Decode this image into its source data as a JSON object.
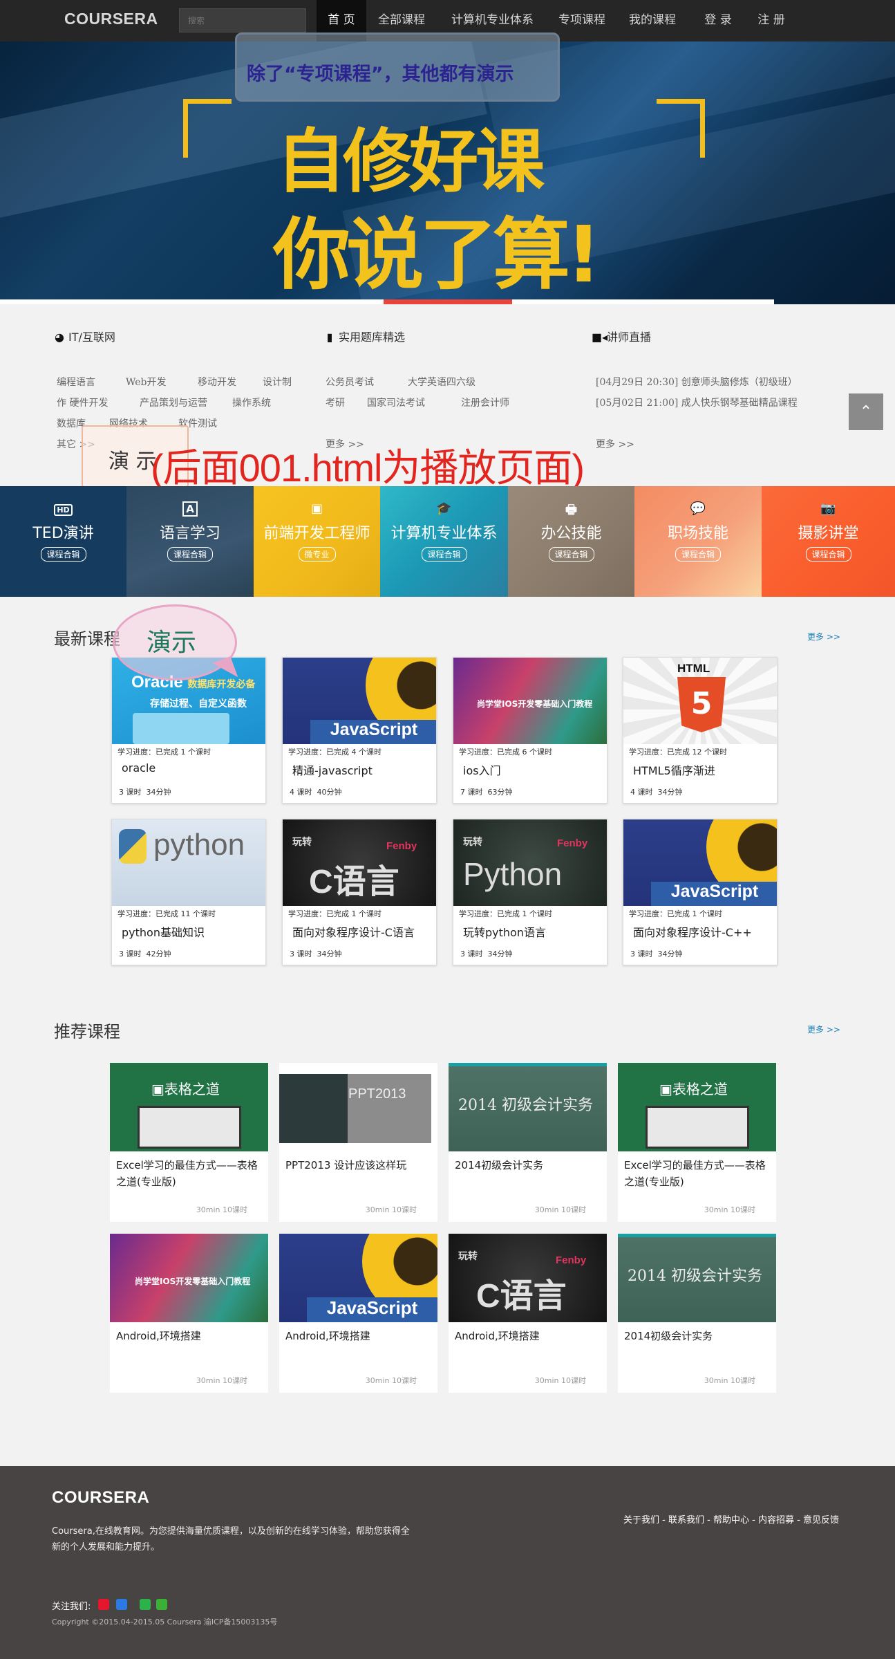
{
  "header": {
    "logo": "COURSERA",
    "search_placeholder": "搜索",
    "nav": [
      "首 页",
      "全部课程",
      "计算机专业体系",
      "专项课程",
      "我的课程",
      "登 录",
      "注 册"
    ]
  },
  "banner": {
    "demo_note": "除了“专项课程”，其他都有演示",
    "line1": "自修好课",
    "line2": "你说了算!"
  },
  "categories": {
    "col1": {
      "title": "IT/互联网",
      "icon": "globe-icon",
      "rows": [
        [
          "编程语言",
          "Web开发",
          "移动开发",
          "设计制"
        ],
        [
          "作 硬件开发",
          "产品策划与运营",
          "操作系统"
        ],
        [
          "数据库",
          "网络技术",
          "软件测试"
        ],
        [
          "其它 >>"
        ]
      ]
    },
    "col2": {
      "title": "实用题库精选",
      "icon": "book-icon",
      "rows": [
        [
          "公务员考试",
          "大学英语四六级"
        ],
        [
          "考研",
          "国家司法考试",
          "注册会计师"
        ],
        [
          "更多 >>"
        ]
      ]
    },
    "col3": {
      "title": "讲师直播",
      "icon": "video-camera-icon",
      "rows": [
        "[04月29日 20:30] 创意师头脑修炼（初级班）",
        "[05月02日 21:00] 成人快乐钢琴基础精品课程",
        "更多 >>"
      ]
    },
    "demo_label": "演 示",
    "red_note": "(后面001.html为播放页面)"
  },
  "tiles": [
    {
      "name": "TED演讲",
      "badge": "课程合辑",
      "icon": "HD",
      "color": "#153c5e"
    },
    {
      "name": "语言学习",
      "badge": "课程合辑",
      "icon": "A",
      "color": "#2c4960"
    },
    {
      "name": "前端开发工程师",
      "badge": "微专业",
      "icon": "▣",
      "color": "#f3c01f"
    },
    {
      "name": "计算机专业体系",
      "badge": "课程合辑",
      "icon": "🎓",
      "color": "#28aabd"
    },
    {
      "name": "办公技能",
      "badge": "课程合辑",
      "icon": "🖶",
      "color": "#8f8070"
    },
    {
      "name": "职场技能",
      "badge": "课程合辑",
      "icon": "💬",
      "color": "#f29668"
    },
    {
      "name": "摄影讲堂",
      "badge": "课程合辑",
      "icon": "📷",
      "color": "#fb6432"
    }
  ],
  "latest": {
    "title": "最新课程",
    "more": "更多 >>",
    "demo_label": "演示",
    "courses": [
      {
        "progress": "学习进度：已完成 1 个课时",
        "title": "oracle",
        "lessons": "3 课时",
        "duration": "34分钟",
        "thumb": "Oracle 数据库开发必备 存储过程、自定义函数"
      },
      {
        "progress": "学习进度：已完成 4 个课时",
        "title": "精通-javascript",
        "lessons": "4 课时",
        "duration": "40分钟",
        "thumb": "JavaScript"
      },
      {
        "progress": "学习进度：已完成 6 个课时",
        "title": "ios入门",
        "lessons": "7 课时",
        "duration": "63分钟",
        "thumb": "尚学堂IOS开发零基础入门教程"
      },
      {
        "progress": "学习进度：已完成 12 个课时",
        "title": "HTML5循序渐进",
        "lessons": "4 课时",
        "duration": "34分钟",
        "thumb": "HTML 5"
      },
      {
        "progress": "学习进度：已完成 11 个课时",
        "title": "python基础知识",
        "lessons": "3 课时",
        "duration": "42分钟",
        "thumb": "python"
      },
      {
        "progress": "学习进度：已完成 1 个课时",
        "title": "面向对象程序设计-C语言",
        "lessons": "3 课时",
        "duration": "34分钟",
        "thumb": "玩转 C语言 Fenby"
      },
      {
        "progress": "学习进度：已完成 1 个课时",
        "title": "玩转python语言",
        "lessons": "3 课时",
        "duration": "34分钟",
        "thumb": "玩转 Python Fenby"
      },
      {
        "progress": "学习进度：已完成 1 个课时",
        "title": "面向对象程序设计-C++",
        "lessons": "3 课时",
        "duration": "34分钟",
        "thumb": "JavaScript"
      }
    ]
  },
  "recommended": {
    "title": "推荐课程",
    "more": "更多 >>",
    "courses": [
      {
        "title": "Excel学习的最佳方式——表格之道(专业版)",
        "meta": "30min 10课时",
        "thumb": "表格之道"
      },
      {
        "title": "PPT2013 设计应该这样玩",
        "meta": "30min 10课时",
        "thumb": "PPT2013"
      },
      {
        "title": "2014初级会计实务",
        "meta": "30min 10课时",
        "thumb": "2014 初级会计实务"
      },
      {
        "title": "Excel学习的最佳方式——表格之道(专业版)",
        "meta": "30min 10课时",
        "thumb": "表格之道"
      },
      {
        "title": "Android,环境搭建",
        "meta": "30min 10课时",
        "thumb": "尚学堂IOS开发零基础入门教程"
      },
      {
        "title": "Android,环境搭建",
        "meta": "30min 10课时",
        "thumb": "JavaScript"
      },
      {
        "title": "Android,环境搭建",
        "meta": "30min 10课时",
        "thumb": "玩转 C语言 Fenby"
      },
      {
        "title": "2014初级会计实务",
        "meta": "30min 10课时",
        "thumb": "2014 初级会计实务"
      }
    ]
  },
  "footer": {
    "logo": "COURSERA",
    "description": "Coursera,在线教育网。为您提供海量优质课程，以及创新的在线学习体验，帮助您获得全新的个人发展和能力提升。",
    "links": [
      "关于我们",
      "联系我们",
      "帮助中心",
      "内容招募",
      "意见反馈"
    ],
    "follow": "关注我们:",
    "copyright": "Copyright ©2015.04-2015.05  Coursera      渝ICP备15003135号"
  }
}
